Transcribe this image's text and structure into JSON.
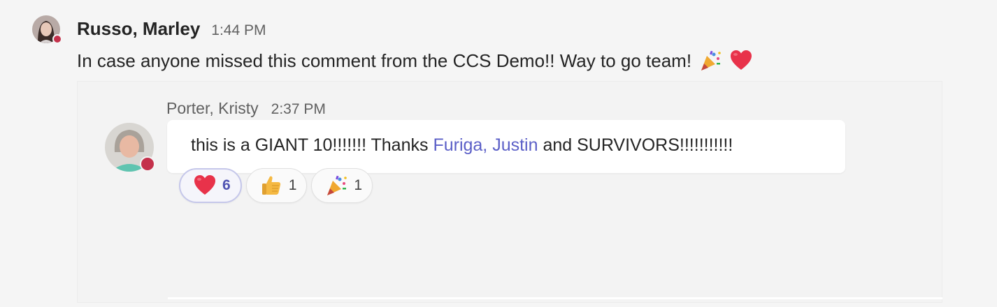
{
  "message": {
    "sender": "Russo, Marley",
    "time": "1:44 PM",
    "text": "In case anyone missed this comment from the CCS Demo!! Way to go team!",
    "emojis": [
      "party-popper",
      "red-heart"
    ],
    "presence_color": "#c4314b"
  },
  "quote": {
    "sender": "Porter, Kristy",
    "time": "2:37 PM",
    "text_before": "this is a GIANT 10!!!!!!! Thanks ",
    "mention": "Furiga, Justin",
    "text_after": " and SURVIVORS!!!!!!!!!!!",
    "mention_color": "#5b5fc7",
    "presence_color": "#c4314b"
  },
  "reactions": [
    {
      "emoji": "red-heart",
      "count": "6",
      "selected": true
    },
    {
      "emoji": "thumbs-up",
      "count": "1",
      "selected": false
    },
    {
      "emoji": "party-popper",
      "count": "1",
      "selected": false
    }
  ]
}
